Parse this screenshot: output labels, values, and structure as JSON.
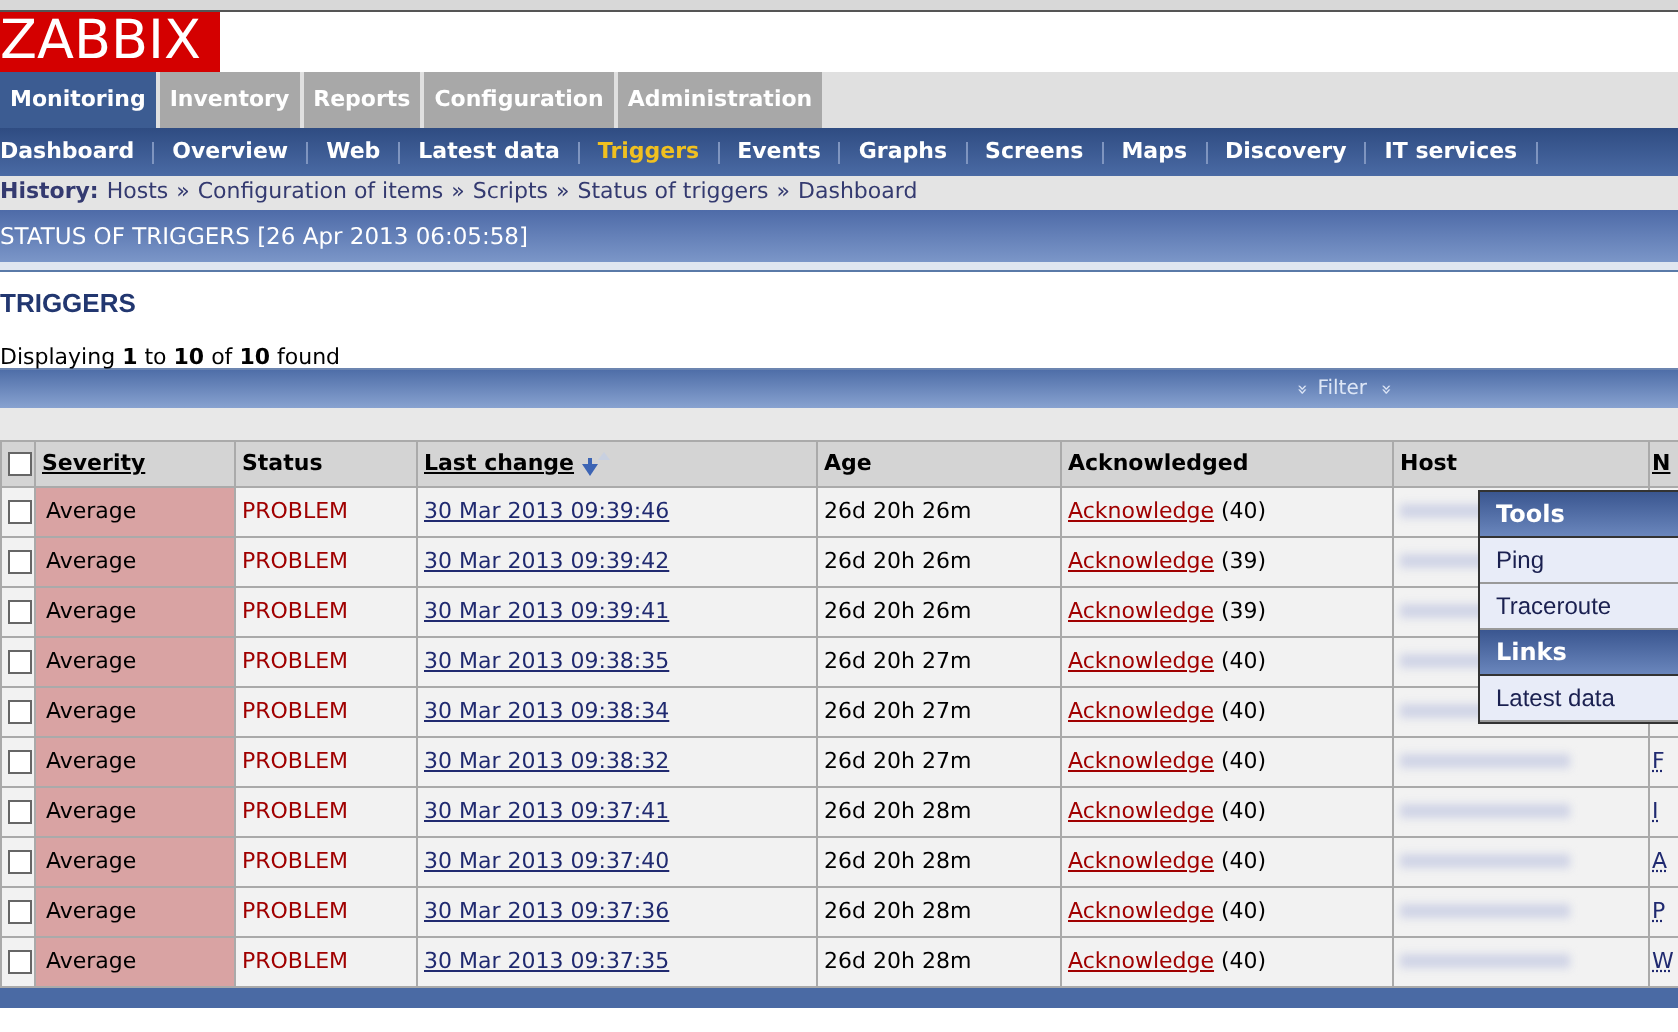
{
  "logo": "ZABBIX",
  "main_menu": [
    {
      "label": "Monitoring",
      "selected": true
    },
    {
      "label": "Inventory",
      "selected": false
    },
    {
      "label": "Reports",
      "selected": false
    },
    {
      "label": "Configuration",
      "selected": false
    },
    {
      "label": "Administration",
      "selected": false
    }
  ],
  "sub_menu": [
    {
      "label": "Dashboard",
      "selected": false
    },
    {
      "label": "Overview",
      "selected": false
    },
    {
      "label": "Web",
      "selected": false
    },
    {
      "label": "Latest data",
      "selected": false
    },
    {
      "label": "Triggers",
      "selected": true
    },
    {
      "label": "Events",
      "selected": false
    },
    {
      "label": "Graphs",
      "selected": false
    },
    {
      "label": "Screens",
      "selected": false
    },
    {
      "label": "Maps",
      "selected": false
    },
    {
      "label": "Discovery",
      "selected": false
    },
    {
      "label": "IT services",
      "selected": false
    }
  ],
  "history": {
    "label": "History:",
    "items": [
      "Hosts",
      "Configuration of items",
      "Scripts",
      "Status of triggers",
      "Dashboard"
    ],
    "separator": "»"
  },
  "page_title": "STATUS OF TRIGGERS [26 Apr 2013 06:05:58]",
  "section_title": "TRIGGERS",
  "displaying": "Displaying **1** to **10** of **10** found",
  "filter": {
    "label": "Filter",
    "icon": "»"
  },
  "table": {
    "select_all": {
      "checked": false
    },
    "columns": [
      {
        "label": "Severity",
        "sortable": true,
        "sorted": false
      },
      {
        "label": "Status",
        "sortable": false
      },
      {
        "label": "Last change",
        "sortable": true,
        "sorted": true
      },
      {
        "label": "Age",
        "sortable": false
      },
      {
        "label": "Acknowledged",
        "sortable": false
      },
      {
        "label": "Host",
        "sortable": false
      },
      {
        "label": "N",
        "sortable": true,
        "sorted": false
      }
    ],
    "rows": [
      {
        "checked": false,
        "severity": "Average",
        "status": "PROBLEM",
        "last_change": "30 Mar 2013 09:39:46",
        "age": "26d 20h 26m",
        "ack_link": "Acknowledge",
        "ack_count": "(40)"
      },
      {
        "checked": false,
        "severity": "Average",
        "status": "PROBLEM",
        "last_change": "30 Mar 2013 09:39:42",
        "age": "26d 20h 26m",
        "ack_link": "Acknowledge",
        "ack_count": "(39)"
      },
      {
        "checked": false,
        "severity": "Average",
        "status": "PROBLEM",
        "last_change": "30 Mar 2013 09:39:41",
        "age": "26d 20h 26m",
        "ack_link": "Acknowledge",
        "ack_count": "(39)"
      },
      {
        "checked": false,
        "severity": "Average",
        "status": "PROBLEM",
        "last_change": "30 Mar 2013 09:38:35",
        "age": "26d 20h 27m",
        "ack_link": "Acknowledge",
        "ack_count": "(40)"
      },
      {
        "checked": false,
        "severity": "Average",
        "status": "PROBLEM",
        "last_change": "30 Mar 2013 09:38:34",
        "age": "26d 20h 27m",
        "ack_link": "Acknowledge",
        "ack_count": "(40)"
      },
      {
        "checked": false,
        "severity": "Average",
        "status": "PROBLEM",
        "last_change": "30 Mar 2013 09:38:32",
        "age": "26d 20h 27m",
        "ack_link": "Acknowledge",
        "ack_count": "(40)",
        "column_7": "F"
      },
      {
        "checked": false,
        "severity": "Average",
        "status": "PROBLEM",
        "last_change": "30 Mar 2013 09:37:41",
        "age": "26d 20h 28m",
        "ack_link": "Acknowledge",
        "ack_count": "(40)",
        "column_7": "I"
      },
      {
        "checked": false,
        "severity": "Average",
        "status": "PROBLEM",
        "last_change": "30 Mar 2013 09:37:40",
        "age": "26d 20h 28m",
        "ack_link": "Acknowledge",
        "ack_count": "(40)",
        "column_7": "A"
      },
      {
        "checked": false,
        "severity": "Average",
        "status": "PROBLEM",
        "last_change": "30 Mar 2013 09:37:36",
        "age": "26d 20h 28m",
        "ack_link": "Acknowledge",
        "ack_count": "(40)",
        "column_7": "P"
      },
      {
        "checked": false,
        "severity": "Average",
        "status": "PROBLEM",
        "last_change": "30 Mar 2013 09:37:35",
        "age": "26d 20h 28m",
        "ack_link": "Acknowledge",
        "ack_count": "(40)",
        "column_7": "W"
      }
    ]
  },
  "host_menu": {
    "sections": [
      {
        "title": "Tools",
        "items": [
          "Ping",
          "Traceroute"
        ]
      },
      {
        "title": "Links",
        "items": [
          "Latest data"
        ]
      }
    ]
  }
}
